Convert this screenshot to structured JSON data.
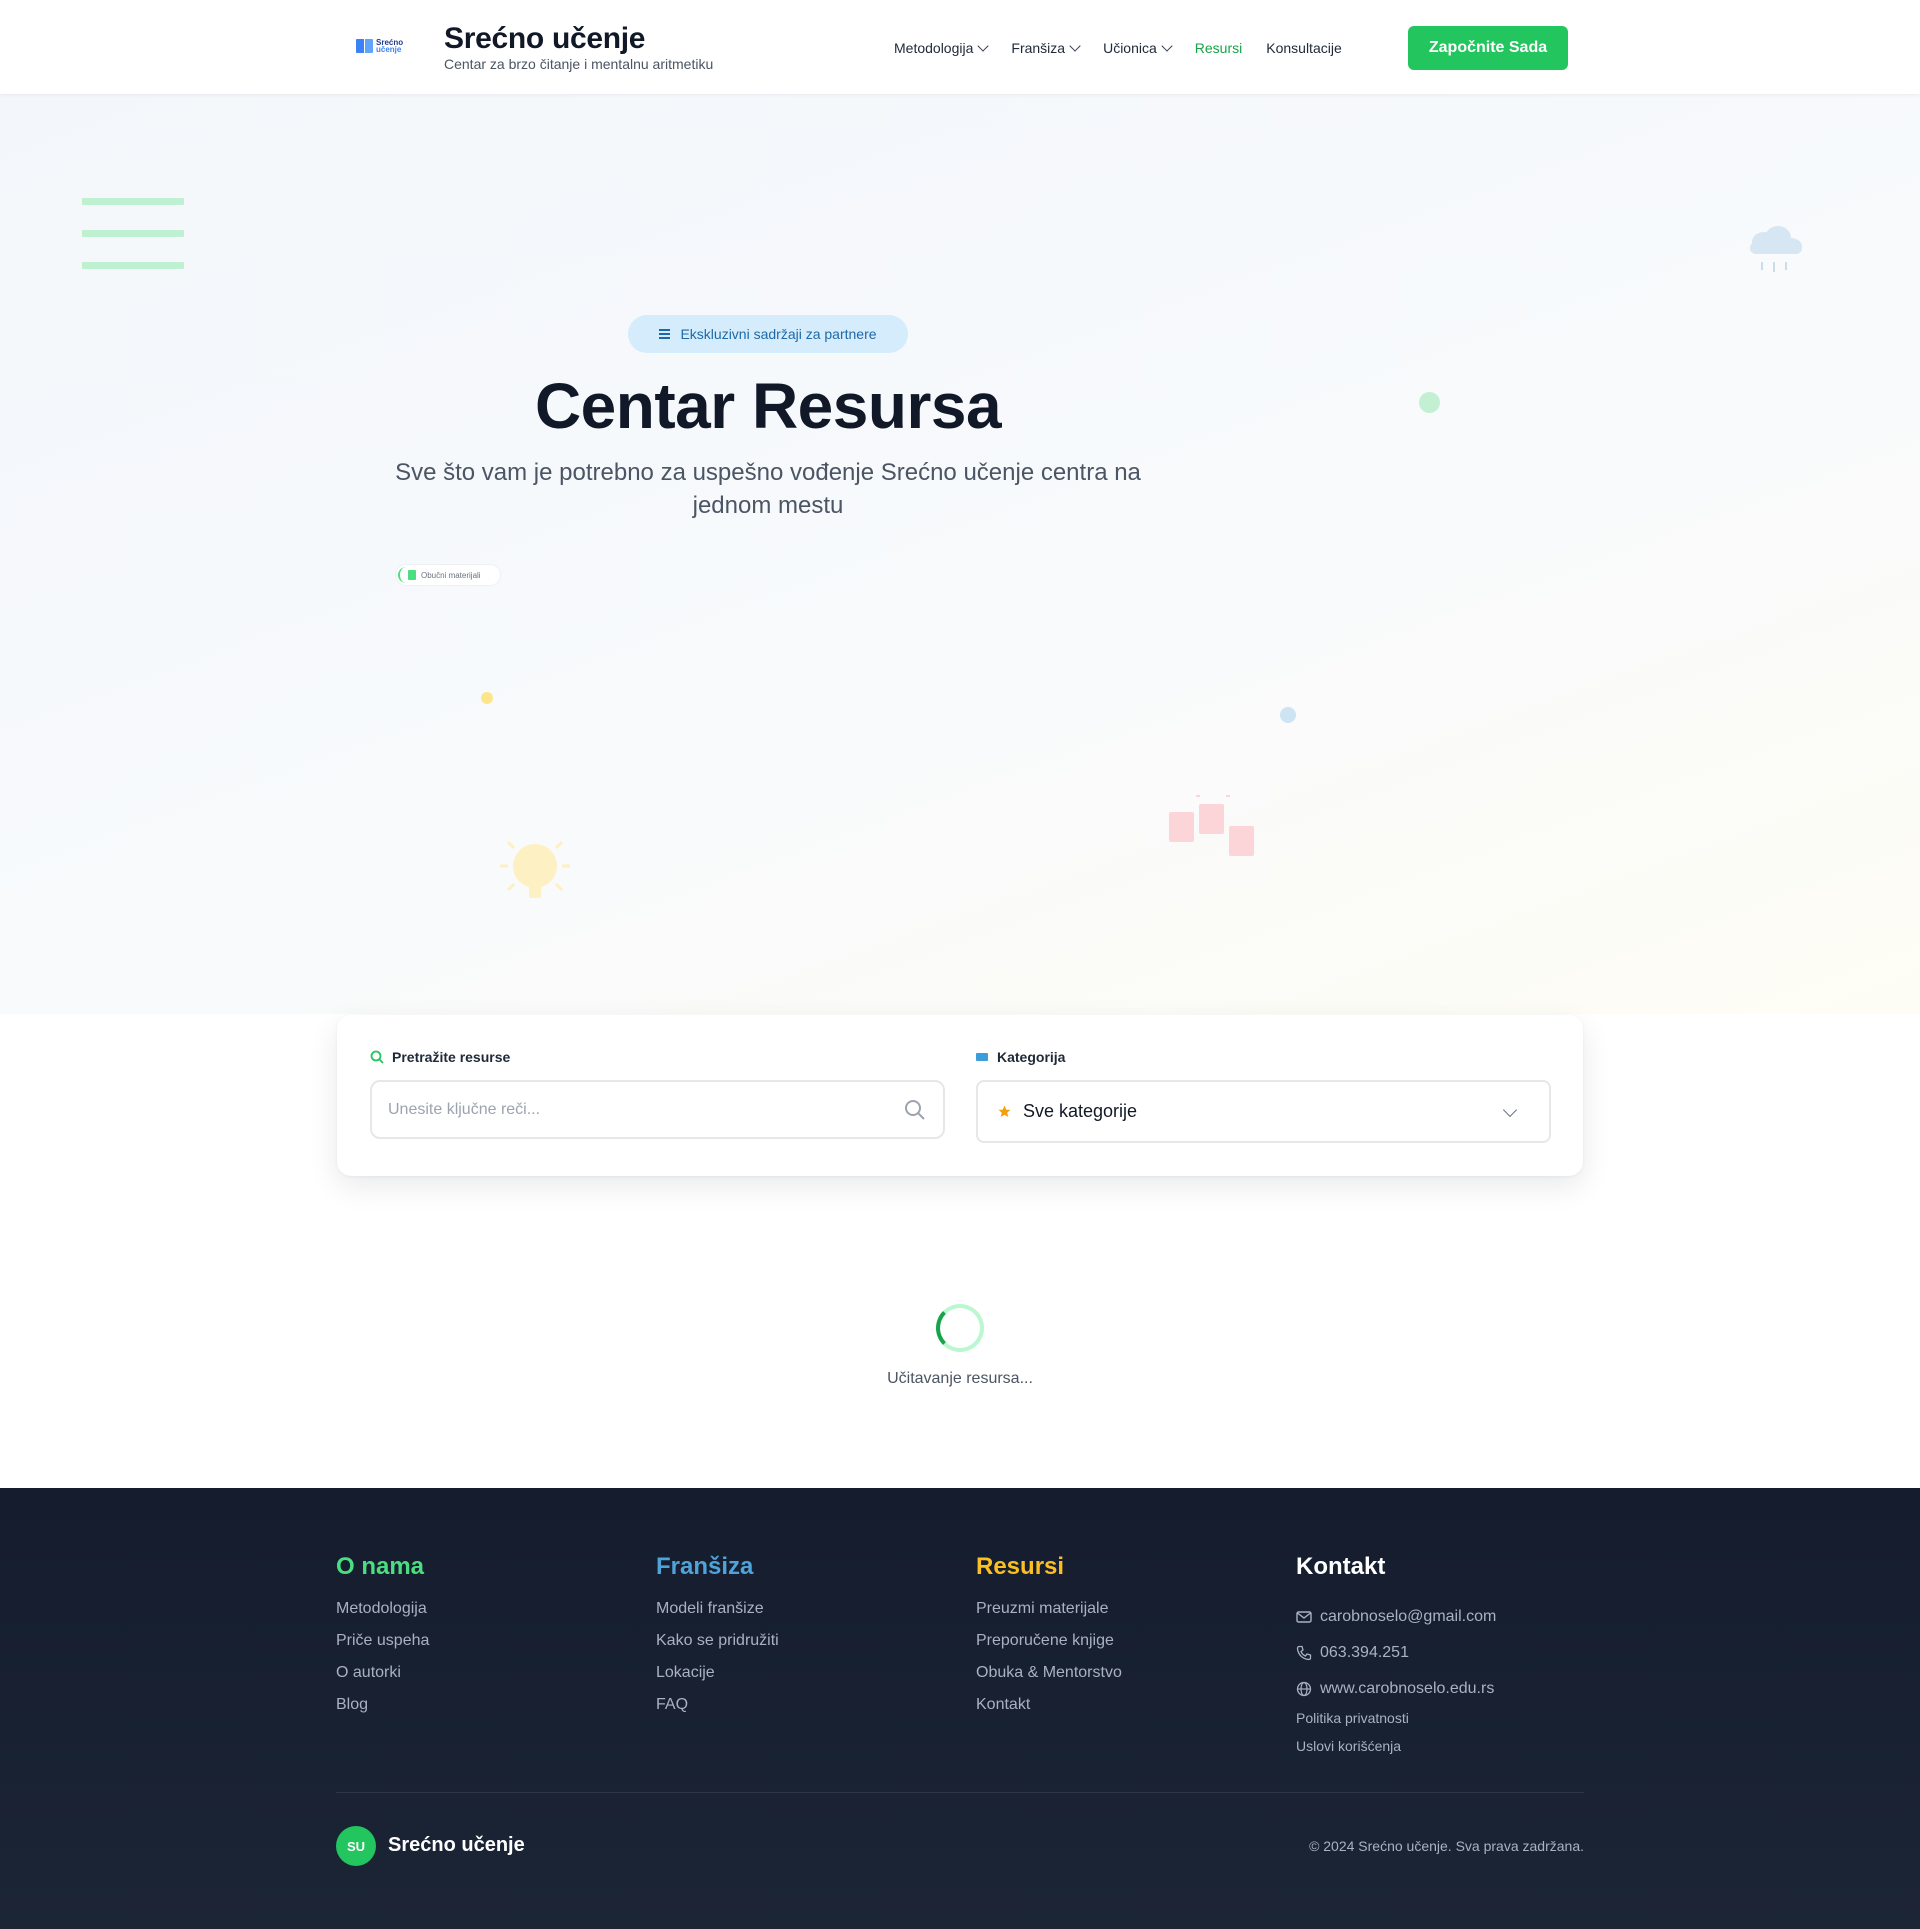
{
  "header": {
    "logo_mini_line1": "Srećno",
    "logo_mini_line2": "učenje",
    "brand_title": "Srećno učenje",
    "brand_subtitle": "Centar za brzo čitanje i mentalnu aritmetiku",
    "nav": {
      "metodologija": "Metodologija",
      "fransiza": "Franšiza",
      "ucionica": "Učionica",
      "resursi": "Resursi",
      "konsultacije": "Konsultacije"
    },
    "cta_label": "Započnite Sada"
  },
  "hero": {
    "badge": "Ekskluzivni sadržaji za partnere",
    "title": "Centar Resursa",
    "subtitle": "Sve što vam je potrebno za uspešno vođenje Srećno učenje centra na jednom mestu",
    "mini_pill": "Obučni materijali"
  },
  "search": {
    "label": "Pretražite resurse",
    "placeholder": "Unesite ključne reči...",
    "value": ""
  },
  "category": {
    "label": "Kategorija",
    "selected": "Sve kategorije"
  },
  "loading": {
    "text": "Učitavanje resursa..."
  },
  "footer": {
    "about": {
      "title": "O nama",
      "links": [
        "Metodologija",
        "Priče uspeha",
        "O autorki",
        "Blog"
      ]
    },
    "franchise": {
      "title": "Franšiza",
      "links": [
        "Modeli franšize",
        "Kako se pridružiti",
        "Lokacije",
        "FAQ"
      ]
    },
    "resources": {
      "title": "Resursi",
      "links": [
        "Preuzmi materijale",
        "Preporučene knjige",
        "Obuka & Mentorstvo",
        "Kontakt"
      ]
    },
    "contact": {
      "title": "Kontakt",
      "email": "carobnoselo@gmail.com",
      "phone": "063.394.251",
      "website": "www.carobnoselo.edu.rs",
      "privacy": "Politika privatnosti",
      "terms": "Uslovi korišćenja"
    },
    "logo_initials": "SU",
    "brand": "Srećno učenje",
    "copyright": "© 2024 Srećno učenje. Sva prava zadržana."
  },
  "colors": {
    "primary_green": "#22c55e",
    "active_nav": "#16a34a",
    "footer_about": "#4ade80",
    "footer_franchise": "#4fa3d8",
    "footer_resources": "#fbbf24",
    "footer_contact": "#ffffff",
    "footer_bg": "#141c2e"
  },
  "icons": {
    "badge": "list-icon",
    "search_label": "search-icon",
    "category_label": "folder-icon",
    "category_option": "star-icon",
    "email": "mail-icon",
    "phone": "phone-icon",
    "website": "globe-icon"
  }
}
